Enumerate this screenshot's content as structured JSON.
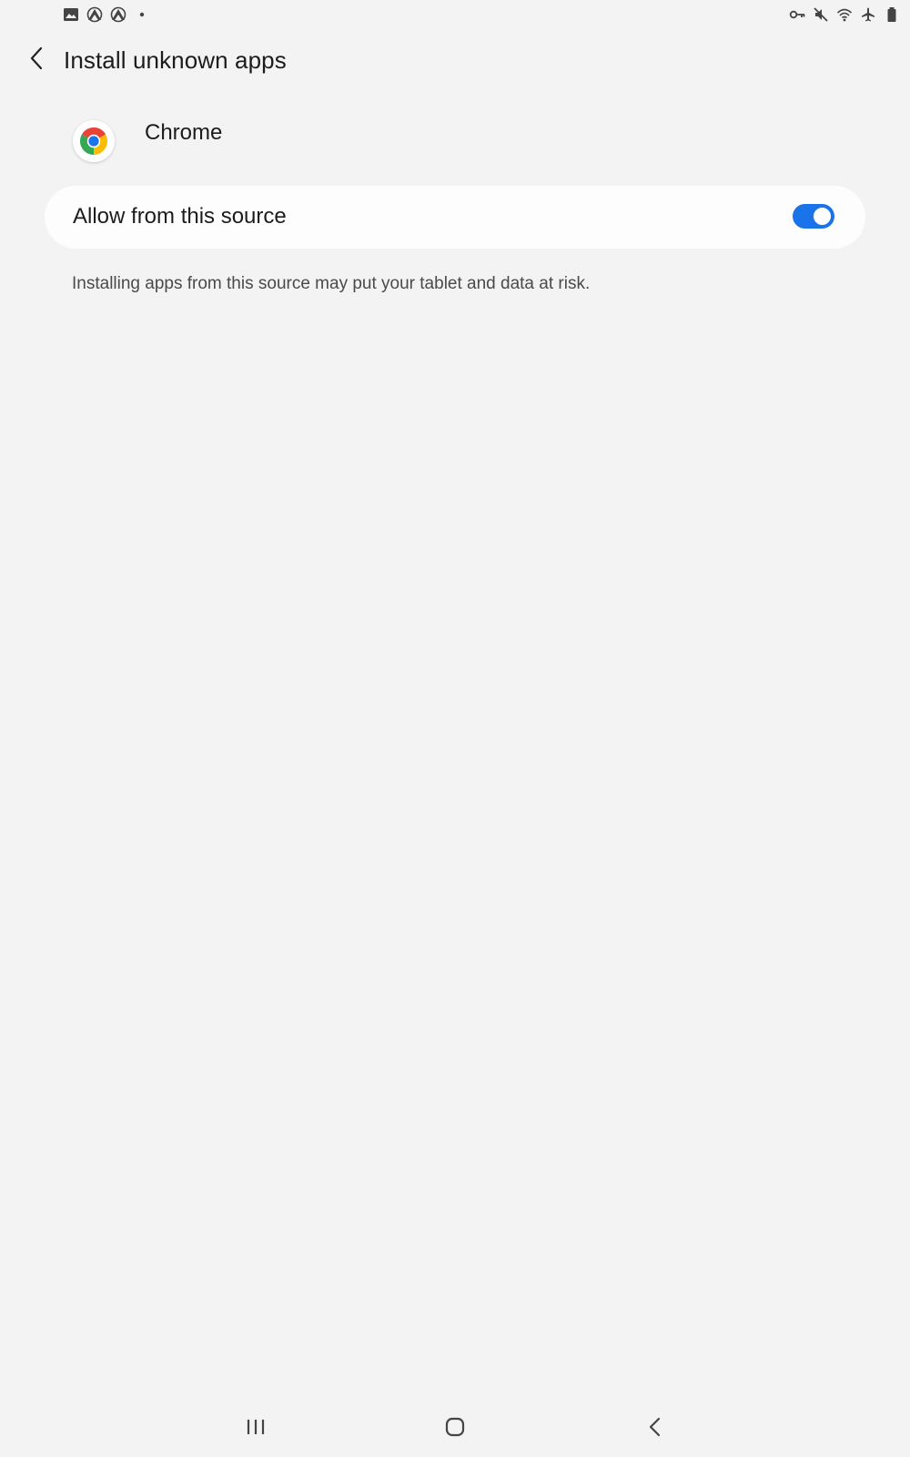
{
  "status_bar": {
    "left_icons": [
      "image-icon",
      "nordvpn-icon",
      "nordvpn-icon",
      "dot-icon"
    ],
    "right_icons": [
      "vpn-key-icon",
      "mute-icon",
      "wifi-icon",
      "airplane-icon",
      "battery-icon"
    ]
  },
  "header": {
    "title": "Install unknown apps",
    "back_icon": "chevron-left-icon"
  },
  "app": {
    "name": "Chrome",
    "icon": "chrome-icon"
  },
  "allow_source": {
    "label": "Allow from this source",
    "enabled": true
  },
  "warning": {
    "text": "Installing apps from this source may put your tablet and data at risk."
  },
  "nav_bar": {
    "buttons": [
      "recents-icon",
      "home-icon",
      "back-icon"
    ]
  },
  "colors": {
    "background": "#f3f3f3",
    "card": "#fdfdfd",
    "accent": "#1a73e8",
    "secondary_text": "#4a4a4a"
  }
}
